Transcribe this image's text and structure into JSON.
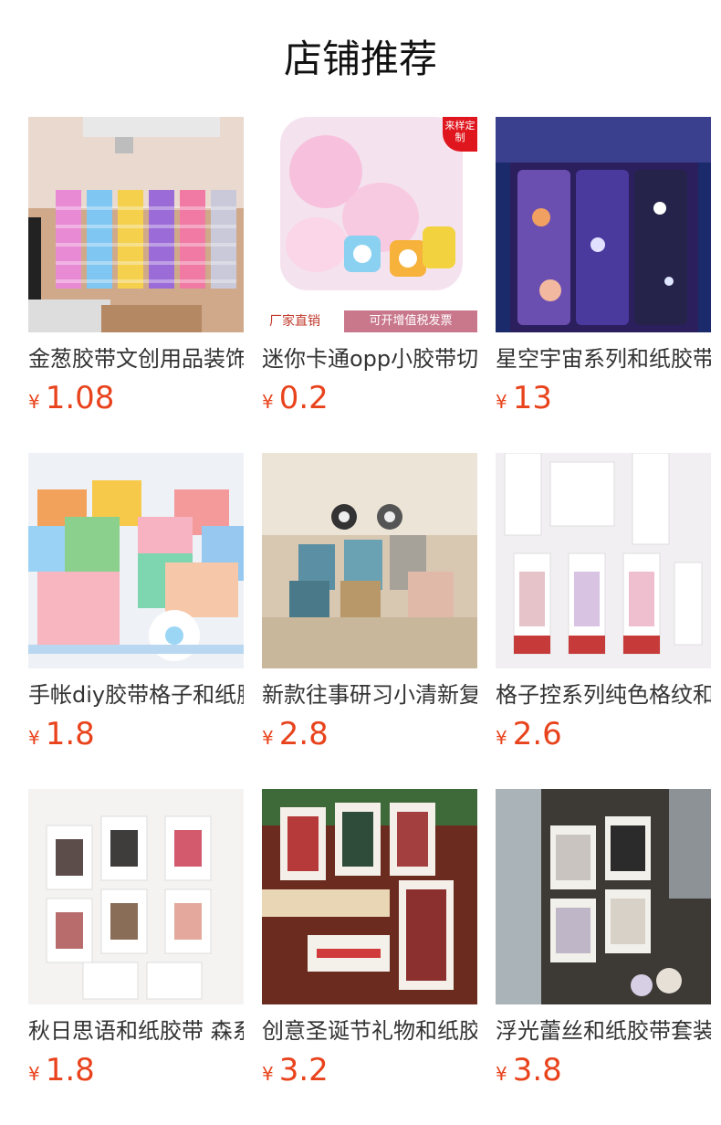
{
  "header": {
    "title": "店铺推荐"
  },
  "currency_symbol": "¥",
  "accent_color": "#e8431c",
  "products": [
    {
      "name": "金葱胶带文创用品装饰手账胶带",
      "price": "1.08"
    },
    {
      "name": "迷你卡通opp小胶带切割器",
      "price": "0.2",
      "badge": "来样定制",
      "strip_left": "厂家直销",
      "strip_right": "可开增值税发票"
    },
    {
      "name": "星空宇宙系列和纸胶带套装",
      "price": "13"
    },
    {
      "name": "手帐diy胶带格子和纸胶带",
      "price": "1.8"
    },
    {
      "name": "新款往事研习小清新复古胶带",
      "price": "2.8"
    },
    {
      "name": "格子控系列纯色格纹和纸胶带",
      "price": "2.6"
    },
    {
      "name": "秋日思语和纸胶带 森系",
      "price": "1.8"
    },
    {
      "name": "创意圣诞节礼物和纸胶带套装",
      "price": "3.2"
    },
    {
      "name": "浮光蕾丝和纸胶带套装",
      "price": "3.8"
    }
  ]
}
